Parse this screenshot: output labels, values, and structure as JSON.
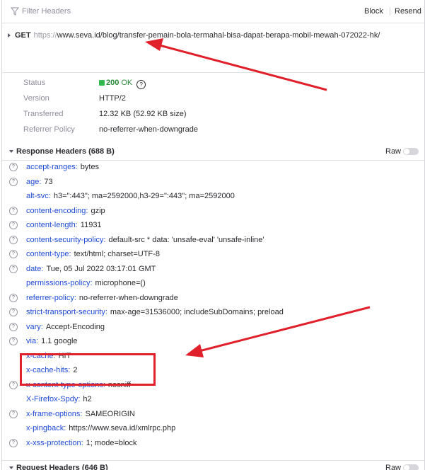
{
  "toolbar": {
    "filter_placeholder": "Filter Headers",
    "block_label": "Block",
    "resend_label": "Resend"
  },
  "request": {
    "method": "GET",
    "url_proto": "https://",
    "url_rest": "www.seva.id/blog/transfer-pemain-bola-termahal-bisa-dapat-berapa-mobil-mewah-072022-hk/"
  },
  "summary": {
    "status_label": "Status",
    "status_code": "200",
    "status_text": "OK",
    "version_label": "Version",
    "version_value": "HTTP/2",
    "transferred_label": "Transferred",
    "transferred_value": "12.32 KB (52.92 KB size)",
    "referrer_label": "Referrer Policy",
    "referrer_value": "no-referrer-when-downgrade"
  },
  "response_headers": {
    "title": "Response Headers (688 B)",
    "raw_label": "Raw",
    "items": [
      {
        "name": "accept-ranges:",
        "value": "bytes",
        "help": true
      },
      {
        "name": "age:",
        "value": "73",
        "help": true
      },
      {
        "name": "alt-svc:",
        "value": "h3=\":443\"; ma=2592000,h3-29=\":443\"; ma=2592000",
        "help": false
      },
      {
        "name": "content-encoding:",
        "value": "gzip",
        "help": true
      },
      {
        "name": "content-length:",
        "value": "11931",
        "help": true
      },
      {
        "name": "content-security-policy:",
        "value": "default-src * data: 'unsafe-eval' 'unsafe-inline'",
        "help": true
      },
      {
        "name": "content-type:",
        "value": "text/html; charset=UTF-8",
        "help": true
      },
      {
        "name": "date:",
        "value": "Tue, 05 Jul 2022 03:17:01 GMT",
        "help": true
      },
      {
        "name": "permissions-policy:",
        "value": "microphone=()",
        "help": false
      },
      {
        "name": "referrer-policy:",
        "value": "no-referrer-when-downgrade",
        "help": true
      },
      {
        "name": "strict-transport-security:",
        "value": "max-age=31536000; includeSubDomains; preload",
        "help": true
      },
      {
        "name": "vary:",
        "value": "Accept-Encoding",
        "help": true
      },
      {
        "name": "via:",
        "value": "1.1 google",
        "help": true
      },
      {
        "name": "x-cache:",
        "value": "HIT",
        "help": false
      },
      {
        "name": "x-cache-hits:",
        "value": "2",
        "help": false
      },
      {
        "name": "x-content-type-options:",
        "value": "nosniff",
        "help": true
      },
      {
        "name": "X-Firefox-Spdy:",
        "value": "h2",
        "help": false
      },
      {
        "name": "x-frame-options:",
        "value": "SAMEORIGIN",
        "help": true
      },
      {
        "name": "x-pingback:",
        "value": "https://www.seva.id/xmlrpc.php",
        "help": false
      },
      {
        "name": "x-xss-protection:",
        "value": "1; mode=block",
        "help": true
      }
    ]
  },
  "request_headers": {
    "title": "Request Headers (646 B)",
    "raw_label": "Raw"
  },
  "colors": {
    "accent_blue": "#1f4bd6",
    "status_green": "#2a8a3a",
    "annotation_red": "#e0202b"
  }
}
